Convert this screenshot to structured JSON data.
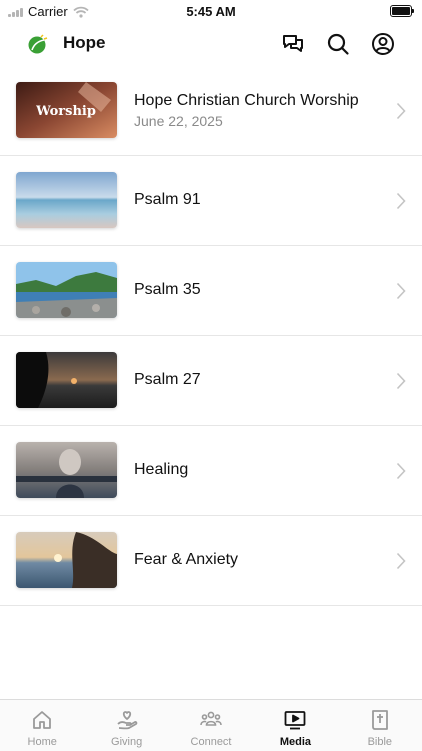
{
  "status_bar": {
    "carrier": "Carrier",
    "time": "5:45 AM"
  },
  "app_bar": {
    "title": "Hope"
  },
  "media_list": [
    {
      "title": "Hope Christian Church Worship",
      "date": "June 22, 2025",
      "thumbnail_text": "Worship"
    },
    {
      "title": "Psalm 91"
    },
    {
      "title": "Psalm 35"
    },
    {
      "title": "Psalm 27"
    },
    {
      "title": "Healing"
    },
    {
      "title": "Fear & Anxiety"
    }
  ],
  "tab_bar": {
    "active": "Media",
    "tabs": [
      {
        "label": "Home",
        "icon": "home-icon"
      },
      {
        "label": "Giving",
        "icon": "giving-icon"
      },
      {
        "label": "Connect",
        "icon": "connect-icon"
      },
      {
        "label": "Media",
        "icon": "media-icon"
      },
      {
        "label": "Bible",
        "icon": "bible-icon"
      }
    ]
  }
}
